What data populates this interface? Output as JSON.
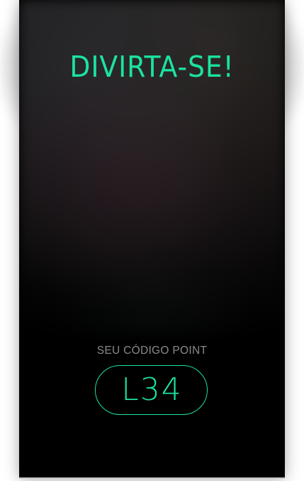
{
  "screen": {
    "title": "DIVIRTA-SE!",
    "code_label": "SEU CÓDIGO POINT",
    "code_value": "L34"
  },
  "colors": {
    "accent": "#1be3a0",
    "background": "#000000",
    "label": "#8a8a8a"
  }
}
